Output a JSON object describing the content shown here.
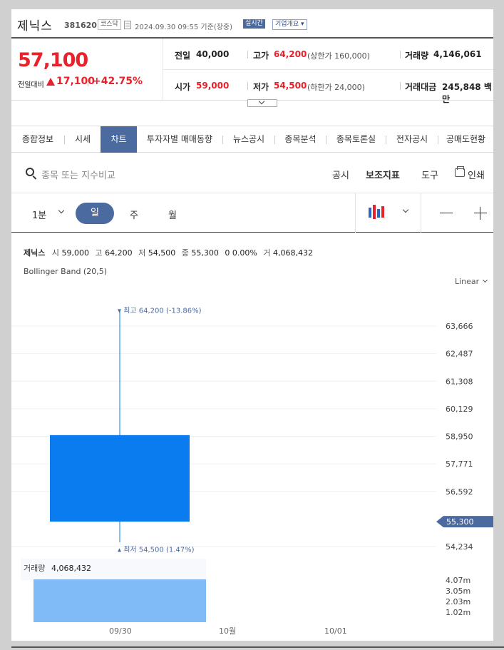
{
  "header": {
    "stock_name": "제닉스",
    "stock_code": "381620",
    "market": "코스닥",
    "datetime": "2024.09.30 09:55 기준(장중)",
    "realtime_badge": "실시간",
    "overview_button": "기업개요 ▾"
  },
  "quote": {
    "price": "57,100",
    "change_label": "전일대비",
    "change_amount": "17,100",
    "change_percent": "+42.75%",
    "change_direction": "up",
    "prev_close_label": "전일",
    "prev_close": "40,000",
    "high_label": "고가",
    "high": "64,200",
    "upper_limit": "(상한가 160,000)",
    "volume_label": "거래량",
    "volume": "4,146,061",
    "open_label": "시가",
    "open": "59,000",
    "low_label": "저가",
    "low": "54,500",
    "lower_limit": "(하한가 24,000)",
    "trade_value_label": "거래대금",
    "trade_value": "245,848 백만"
  },
  "tabs": [
    {
      "label": "종합정보",
      "active": false
    },
    {
      "label": "시세",
      "active": false
    },
    {
      "label": "차트",
      "active": true
    },
    {
      "label": "투자자별 매매동향",
      "active": false
    },
    {
      "label": "뉴스공시",
      "active": false
    },
    {
      "label": "종목분석",
      "active": false
    },
    {
      "label": "종목토론실",
      "active": false
    },
    {
      "label": "전자공시",
      "active": false
    },
    {
      "label": "공매도현황",
      "active": false
    }
  ],
  "toolbar": {
    "search_placeholder": "종목 또는 지수비교",
    "disclosure": "공시",
    "indicators": "보조지표",
    "tools": "도구",
    "print": "인쇄"
  },
  "period": {
    "minute_select": "1분",
    "day": "일",
    "week": "주",
    "month": "월"
  },
  "info": {
    "name": "제닉스",
    "open_k": "시",
    "open_v": "59,000",
    "high_k": "고",
    "high_v": "64,200",
    "low_k": "저",
    "low_v": "54,500",
    "close_k": "종",
    "close_v": "55,300",
    "change": "0 0.00%",
    "volume_k": "거",
    "volume_v": "4,068,432"
  },
  "indicator_label": "Bollinger Band (20,5)",
  "scale_select": "Linear",
  "colors": {
    "candle": "#0a7cef",
    "volume_bar": "#80baf7",
    "axis_tag": "#4b6aa0",
    "accent_red": "#e8212b",
    "annotation": "#4b6aa0"
  },
  "chart_data": {
    "type": "candlestick",
    "candles": [
      {
        "x": "09/30",
        "open": 59000,
        "high": 64200,
        "low": 54500,
        "close": 55300,
        "volume": 4068432
      }
    ],
    "price_ticks": [
      "63,666",
      "62,487",
      "61,308",
      "60,129",
      "58,950",
      "57,771",
      "56,592",
      "54,234"
    ],
    "current_price_tag": "55,300",
    "high_annotation": "▾ 최고 64,200 (-13.86%)",
    "low_annotation": "▴ 최저 54,500 (1.47%)",
    "volume_label": "거래량",
    "volume_value": "4,068,432",
    "volume_ticks": [
      "4.07m",
      "3.05m",
      "2.03m",
      "1.02m"
    ],
    "x_ticks": [
      "09/30",
      "10월",
      "10/01"
    ]
  }
}
